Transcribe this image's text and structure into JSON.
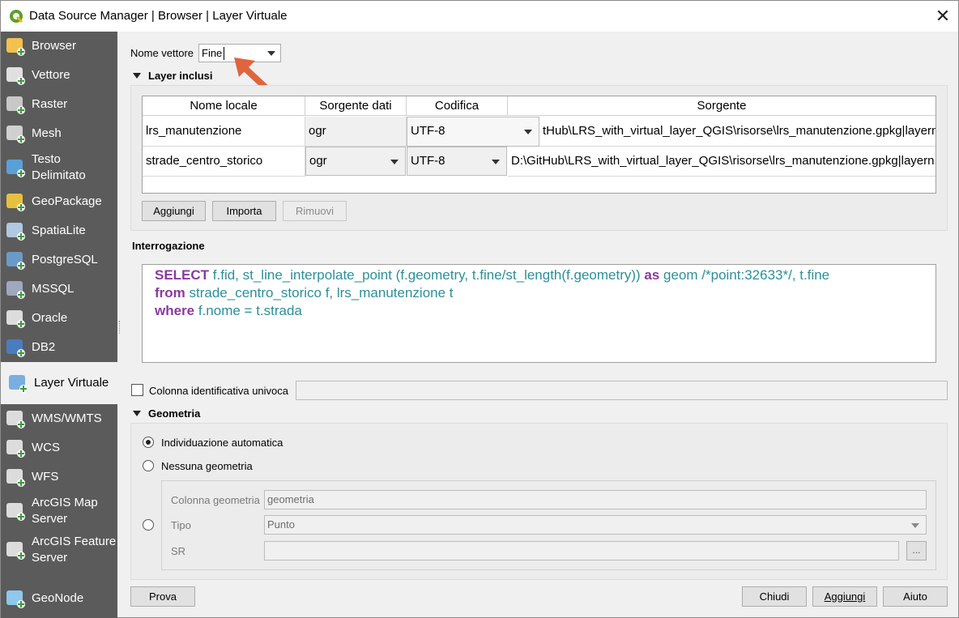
{
  "window": {
    "title": "Data Source Manager | Browser | Layer Virtuale",
    "close_symbol": "✕"
  },
  "sidebar": {
    "items": [
      {
        "label": "Browser",
        "icon": "folder-icon"
      },
      {
        "label": "Vettore",
        "icon": "vector-icon"
      },
      {
        "label": "Raster",
        "icon": "raster-icon"
      },
      {
        "label": "Mesh",
        "icon": "mesh-icon"
      },
      {
        "label": "Testo\nDelimitato",
        "line1": "Testo",
        "line2": "Delimitato",
        "icon": "delimited-text-icon"
      },
      {
        "label": "GeoPackage",
        "icon": "geopackage-icon"
      },
      {
        "label": "SpatiaLite",
        "icon": "spatialite-icon"
      },
      {
        "label": "PostgreSQL",
        "icon": "postgresql-icon"
      },
      {
        "label": "MSSQL",
        "icon": "mssql-icon"
      },
      {
        "label": "Oracle",
        "icon": "oracle-icon"
      },
      {
        "label": "DB2",
        "icon": "db2-icon"
      },
      {
        "label": "Layer Virtuale",
        "icon": "virtual-layer-icon"
      },
      {
        "label": "WMS/WMTS",
        "icon": "wms-icon"
      },
      {
        "label": "WCS",
        "icon": "wcs-icon"
      },
      {
        "label": "WFS",
        "icon": "wfs-icon"
      },
      {
        "label": "ArcGIS Map Server",
        "line1": "ArcGIS Map",
        "line2": "Server",
        "icon": "arcgis-map-icon"
      },
      {
        "label": "ArcGIS Feature Server",
        "line1": "ArcGIS Feature",
        "line2": "Server",
        "icon": "arcgis-feature-icon"
      },
      {
        "label": "GeoNode",
        "icon": "geonode-icon"
      }
    ],
    "active": "Layer Virtuale"
  },
  "layer_name": {
    "label": "Nome vettore",
    "value": "Fine"
  },
  "included_layers": {
    "title": "Layer inclusi",
    "columns": [
      "Nome locale",
      "Sorgente dati",
      "Codifica",
      "Sorgente"
    ],
    "rows": [
      {
        "name": "lrs_manutenzione",
        "provider": "ogr",
        "encoding": "UTF-8",
        "source": "tHub\\LRS_with_virtual_layer_QGIS\\risorse\\lrs_manutenzione.gpkg|layern..."
      },
      {
        "name": "strade_centro_storico",
        "provider": "ogr",
        "encoding": "UTF-8",
        "source": "D:\\GitHub\\LRS_with_virtual_layer_QGIS\\risorse\\lrs_manutenzione.gpkg|layern..."
      }
    ],
    "buttons": {
      "add": "Aggiungi",
      "import": "Importa",
      "remove": "Rimuovi"
    }
  },
  "query": {
    "title": "Interrogazione",
    "line1": {
      "kw": "SELECT",
      "rest": " f.fid, st_line_interpolate_point (f.geometry, t.fine/st_length(f.geometry)) ",
      "kw2": "as",
      "rest2": " geom /*point:32633*/,  t.fine"
    },
    "line2": {
      "kw": "from",
      "rest": " strade_centro_storico f, lrs_manutenzione t"
    },
    "line3": {
      "kw": "where",
      "rest": " f.nome = t.strada"
    }
  },
  "unique_id": {
    "label": "Colonna identificativa univoca",
    "checked": false
  },
  "geometry": {
    "title": "Geometria",
    "auto_label": "Individuazione automatica",
    "none_label": "Nessuna geometria",
    "selected": "Individuazione automatica",
    "column_label": "Colonna geometria",
    "column_value": "geometria",
    "type_label": "Tipo",
    "type_value": "Punto",
    "crs_label": "SR",
    "crs_value": "",
    "crs_button": "..."
  },
  "footer": {
    "test": "Prova",
    "close": "Chiudi",
    "add": "Aggiungi",
    "help": "Aiuto"
  },
  "colors": {
    "sidebar_bg": "#5b5b5b",
    "sql_keyword": "#8a3a9e",
    "sql_identifier": "#2c8f9a",
    "arrow_annotation": "#e0643c"
  }
}
